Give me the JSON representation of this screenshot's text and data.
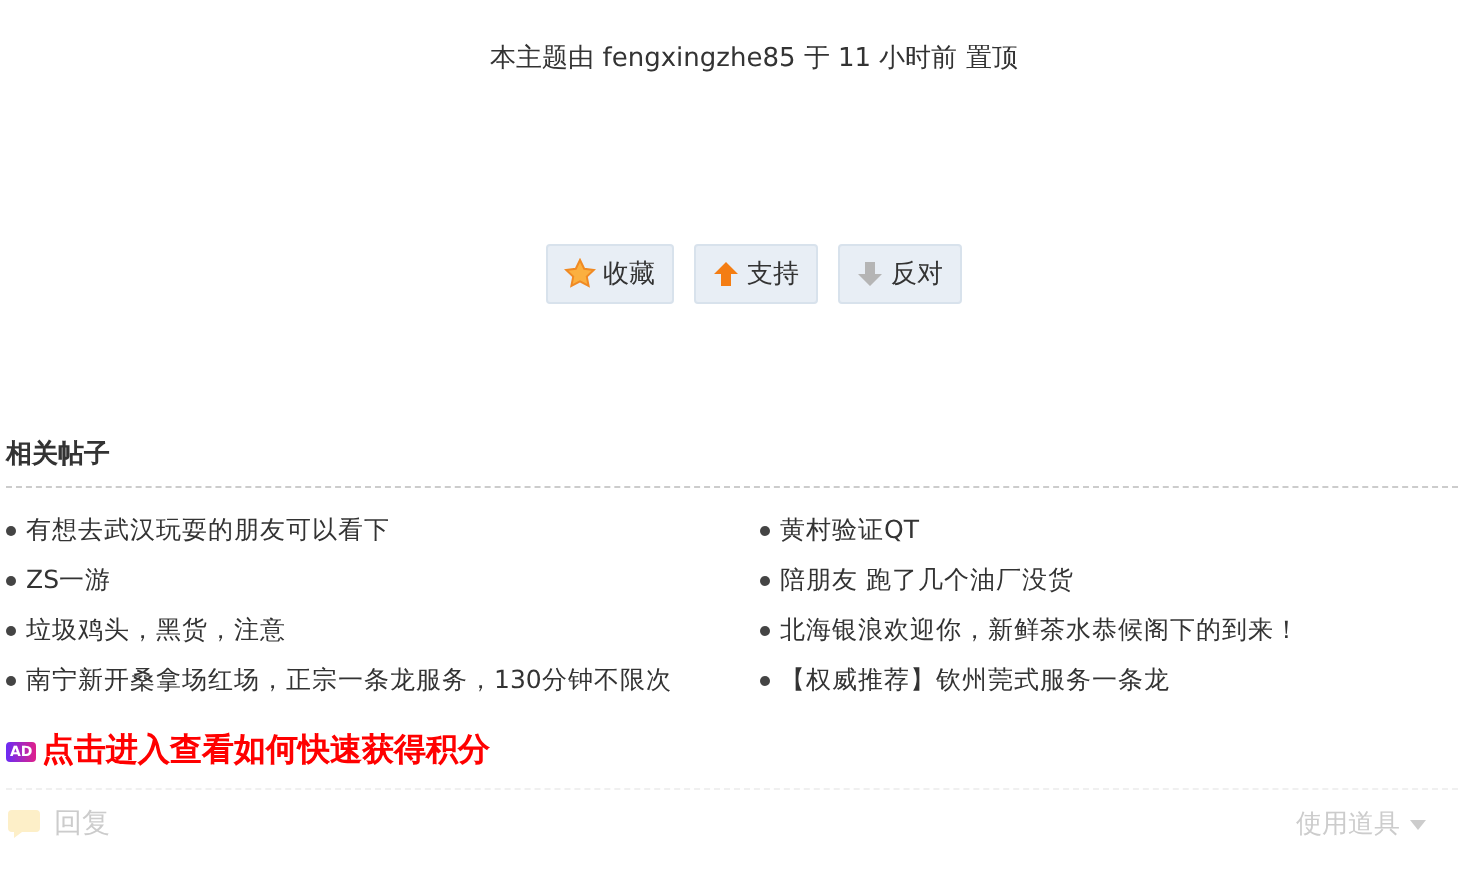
{
  "pin_notice": "本主题由 fengxingzhe85 于 11 小时前 置顶",
  "actions": [
    {
      "kind": "favorite",
      "label": "收藏"
    },
    {
      "kind": "support",
      "label": "支持"
    },
    {
      "kind": "oppose",
      "label": "反对"
    }
  ],
  "related": {
    "title": "相关帖子",
    "items": [
      "有想去武汉玩耍的朋友可以看下",
      "黄村验证QT",
      "ZS一游",
      "陪朋友 跑了几个油厂没货",
      "垃圾鸡头，黑货，注意",
      "北海银浪欢迎你，新鲜茶水恭候阁下的到来！",
      "南宁新开桑拿场红场，正宗一条龙服务，130分钟不限次",
      "【权威推荐】钦州莞式服务一条龙"
    ]
  },
  "ad": {
    "badge": "AD",
    "text": "点击进入查看如何快速获得积分"
  },
  "footer": {
    "reply": "回复",
    "tools": "使用道具"
  }
}
